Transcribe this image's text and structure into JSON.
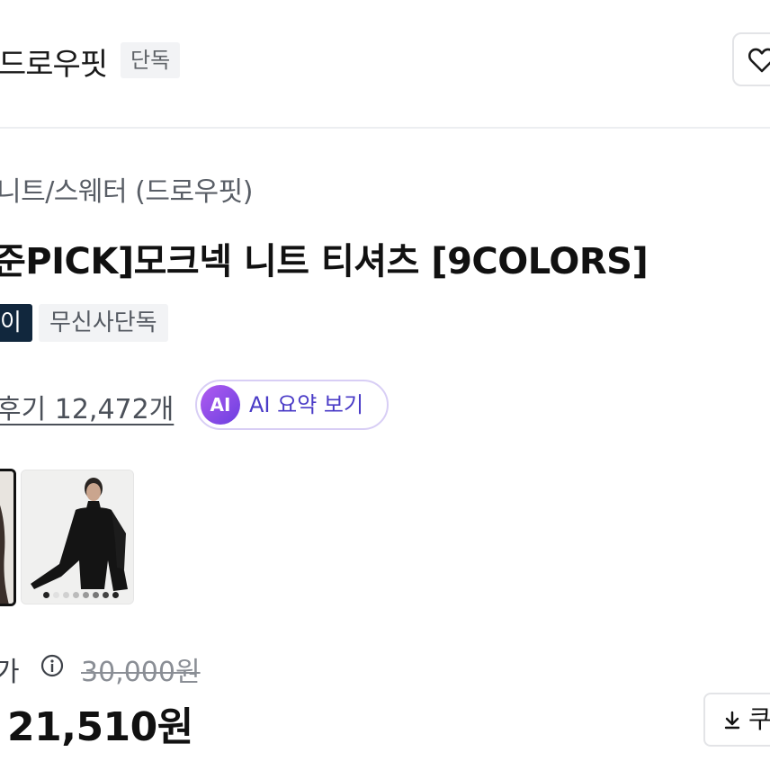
{
  "brand": {
    "name": "드로우핏",
    "badge": "단독"
  },
  "product": {
    "category": "니트/스웨터 (드로우핏)",
    "title": "준PICK]모크넥 니트 티셔츠 [9COLORS]",
    "tags": [
      "이",
      "무신사단독"
    ],
    "review_link": "후기 12,472개",
    "ai_summary": {
      "icon_text": "AI",
      "label": "AI 요약 보기"
    }
  },
  "thumbnails": [
    {
      "icon": "product-photo",
      "selected": true
    },
    {
      "icon": "product-photo-model",
      "selected": false
    }
  ],
  "price": {
    "consumer_label": "가",
    "original": "30,000원",
    "sale": "21,510원",
    "coupon_label": "쿠"
  },
  "colors": {
    "tag_dark": "#11273d",
    "ai_accent": "#6b3fe0"
  }
}
